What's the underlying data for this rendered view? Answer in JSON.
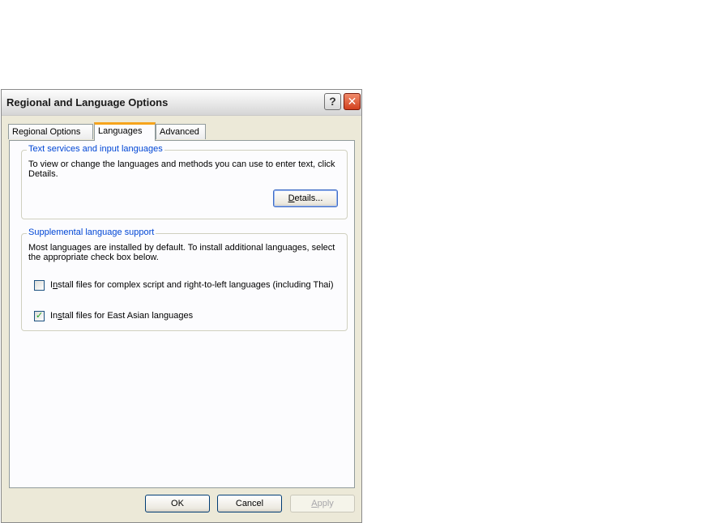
{
  "window": {
    "title": "Regional and Language Options",
    "help_glyph": "?",
    "close_glyph": "✕"
  },
  "tabs": [
    {
      "label": "Regional Options",
      "active": false
    },
    {
      "label": "Languages",
      "active": true
    },
    {
      "label": "Advanced",
      "active": false
    }
  ],
  "text_services": {
    "legend": "Text services and input languages",
    "description": "To view or change the languages and methods you can use to enter text, click Details.",
    "details_button": {
      "mnemonic": "D",
      "rest": "etails..."
    }
  },
  "supplemental": {
    "legend": "Supplemental language support",
    "description": "Most languages are installed by default. To install additional languages, select the appropriate check box below.",
    "options": [
      {
        "pre": "I",
        "mnemonic": "n",
        "rest": "stall files for complex script and right-to-left languages (including Thai)",
        "checked": false
      },
      {
        "pre": "In",
        "mnemonic": "s",
        "rest": "tall files for East Asian languages",
        "checked": true
      }
    ]
  },
  "footer": {
    "ok": "OK",
    "cancel": "Cancel",
    "apply": {
      "mnemonic": "A",
      "rest": "pply"
    }
  },
  "colors": {
    "accent_tab": "#f6a41c",
    "group_legend": "#0046d5",
    "checkmark": "#21a121"
  }
}
